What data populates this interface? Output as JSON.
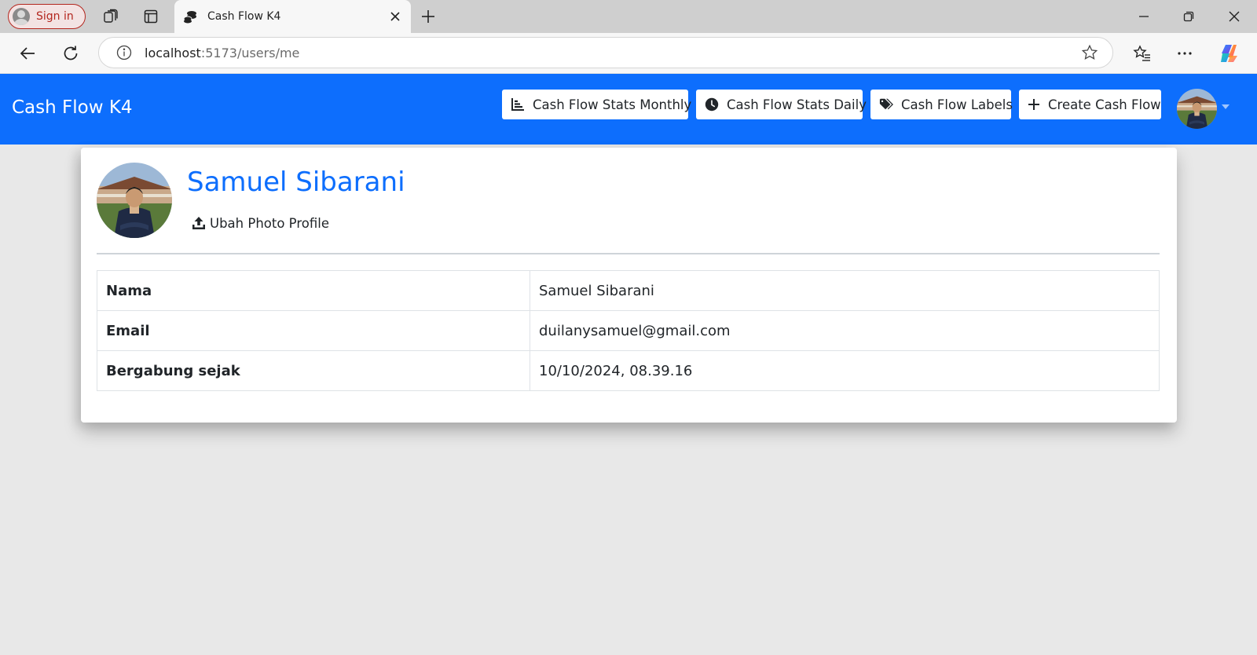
{
  "browser": {
    "signin_label": "Sign in",
    "tab_title": "Cash Flow K4",
    "url_host": "localhost",
    "url_path": ":5173/users/me"
  },
  "navbar": {
    "brand": "Cash Flow K4",
    "buttons": [
      {
        "label": "Cash Flow Stats Monthly",
        "icon": "bar-chart-icon"
      },
      {
        "label": "Cash Flow Stats Daily",
        "icon": "clock-icon"
      },
      {
        "label": "Cash Flow Labels",
        "icon": "tags-icon"
      },
      {
        "label": "Create Cash Flow",
        "icon": "plus-icon"
      }
    ],
    "accent_color": "#0d6efd"
  },
  "profile": {
    "name": "Samuel Sibarani",
    "change_photo_label": "Ubah Photo Profile",
    "fields": [
      {
        "key": "Nama",
        "value": "Samuel Sibarani"
      },
      {
        "key": "Email",
        "value": "duilanysamuel@gmail.com"
      },
      {
        "key": "Bergabung sejak",
        "value": "10/10/2024, 08.39.16"
      }
    ]
  }
}
